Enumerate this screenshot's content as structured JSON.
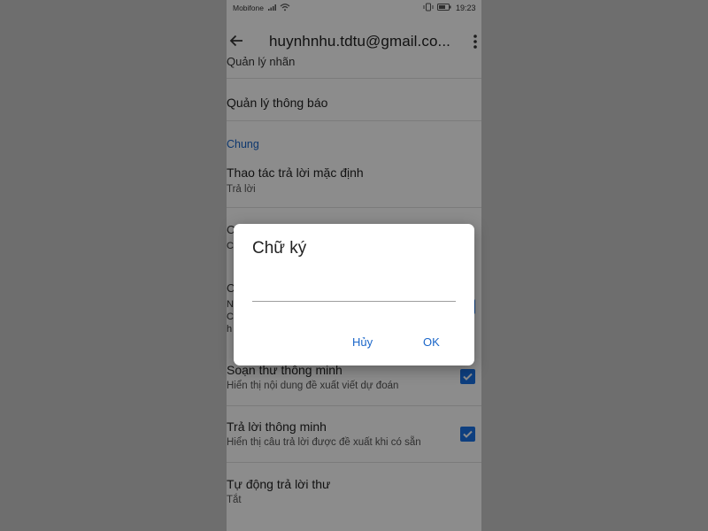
{
  "statusbar": {
    "carrier": "Mobifone",
    "time": "19:23"
  },
  "appbar": {
    "title": "huynhnhu.tdtu@gmail.co..."
  },
  "settings": {
    "partial_top": "Quản lý nhãn",
    "manage_notifications": "Quản lý thông báo",
    "section_general": "Chung",
    "default_reply": {
      "title": "Thao tác trả lời mặc định",
      "subtitle": "Trả lời"
    },
    "hidden_row_a": "C",
    "hidden_row_a_sub": "C",
    "hidden_row_b": "C",
    "hidden_row_b_sub1": "N",
    "hidden_row_b_sub2": "C",
    "hidden_row_b_sub3": "h",
    "smart_compose": {
      "title": "Soạn thư thông minh",
      "subtitle": "Hiển thị nội dung đề xuất viết dự đoán",
      "checked": true
    },
    "smart_reply": {
      "title": "Trả lời thông minh",
      "subtitle": "Hiển thị câu trả lời được đề xuất khi có sẵn",
      "checked": true
    },
    "auto_reply": {
      "title": "Tự động trả lời thư",
      "subtitle": "Tắt"
    }
  },
  "dialog": {
    "title": "Chữ ký",
    "input_value": "",
    "cancel_label": "Hủy",
    "ok_label": "OK"
  },
  "colors": {
    "accent": "#1a73e8",
    "link": "#1a66c9",
    "scrim": "rgba(0,0,0,0.45)"
  }
}
